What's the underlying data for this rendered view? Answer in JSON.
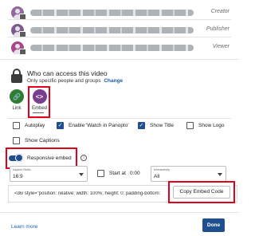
{
  "users": [
    {
      "role": "Creator",
      "avatar_color": "#8f6a9a"
    },
    {
      "role": "Publisher",
      "avatar_color": "#7d5a8e"
    },
    {
      "role": "Viewer",
      "avatar_color": "#a8458b"
    }
  ],
  "access": {
    "title": "Who can access this video",
    "subtitle": "Only specific people and groups",
    "change_label": "Change"
  },
  "share_options": {
    "link_label": "Link",
    "embed_label": "Embed",
    "link_color": "#2e7d32",
    "embed_color": "#7a3e8e"
  },
  "options": {
    "autoplay": {
      "label": "Autoplay",
      "checked": false
    },
    "enable_watch": {
      "label": "Enable 'Watch in Panopto'",
      "checked": true
    },
    "show_title": {
      "label": "Show Title",
      "checked": true
    },
    "show_logo": {
      "label": "Show Logo",
      "checked": false
    },
    "show_captions": {
      "label": "Show Captions",
      "checked": false
    }
  },
  "responsive_embed": {
    "label": "Responsive embed",
    "enabled": true
  },
  "aspect_ratio": {
    "label": "Aspect Ratio",
    "value": "16:9"
  },
  "start_at": {
    "label": "Start at",
    "value": "0:00",
    "checked": false
  },
  "interactivity": {
    "label": "Interactivity",
    "value": "All"
  },
  "embed_code": "<div style=\"position: relative; width: 100%; height: 0; padding-bottom:",
  "copy_button_label": "Copy Embed Code",
  "footer": {
    "learn_more": "Learn more",
    "done": "Done"
  },
  "colors": {
    "accent": "#1f4f8f",
    "highlight": "#e3001b"
  }
}
